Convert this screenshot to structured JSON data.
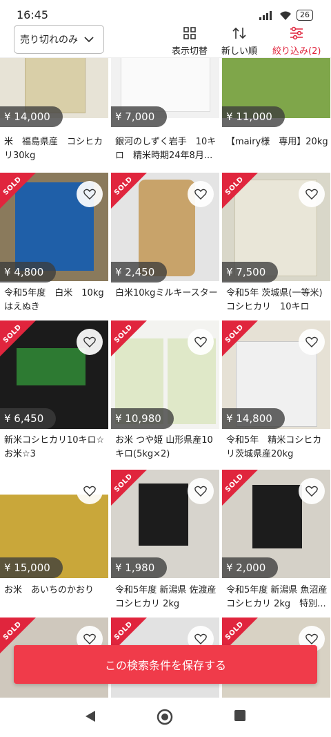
{
  "status": {
    "time": "16:45",
    "battery": "26"
  },
  "toolbar": {
    "dropdown": "売り切れのみ",
    "view_toggle": "表示切替",
    "sort": "新しい順",
    "filter": "絞り込み(2)"
  },
  "items": [
    {
      "price": "¥ 14,000",
      "title": "米　福島県産　コシヒカリ30kg",
      "sold": false
    },
    {
      "price": "¥ 7,000",
      "title": "銀河のしずく岩手　10キロ　精米時期24年8月...",
      "sold": false
    },
    {
      "price": "¥ 11,000",
      "title": "【mairy様　専用】20kg",
      "sold": false
    },
    {
      "price": "¥ 4,800",
      "title": "令和5年度　白米　10kg はえぬき",
      "sold": true
    },
    {
      "price": "¥ 2,450",
      "title": "白米10kgミルキースター",
      "sold": true
    },
    {
      "price": "¥ 7,500",
      "title": "令和5年 茨城県(一等米)コシヒカリ　10キロ",
      "sold": true
    },
    {
      "price": "¥ 6,450",
      "title": "新米コシヒカリ10キロ☆お米☆3",
      "sold": true
    },
    {
      "price": "¥ 10,980",
      "title": "お米 つや姫 山形県産10キロ(5kg×2)",
      "sold": true
    },
    {
      "price": "¥ 14,800",
      "title": "令和5年　精米コシヒカリ茨城県産20kg",
      "sold": true
    },
    {
      "price": "¥ 15,000",
      "title": "お米　あいちのかおり",
      "sold": false
    },
    {
      "price": "¥ 1,980",
      "title": "令和5年度 新潟県 佐渡産コシヒカリ 2kg",
      "sold": true
    },
    {
      "price": "¥ 2,000",
      "title": "令和5年度 新潟県 魚沼産コシヒカリ 2kg　特別...",
      "sold": true
    },
    {
      "price": "",
      "title": "",
      "sold": true
    },
    {
      "price": "",
      "title": "",
      "sold": true
    },
    {
      "price": "",
      "title": "",
      "sold": true
    }
  ],
  "sold_label": "SOLD",
  "save_button": "この検索条件を保存する",
  "colors": {
    "accent": "#e0253d",
    "save_bg": "#f03b4a"
  }
}
